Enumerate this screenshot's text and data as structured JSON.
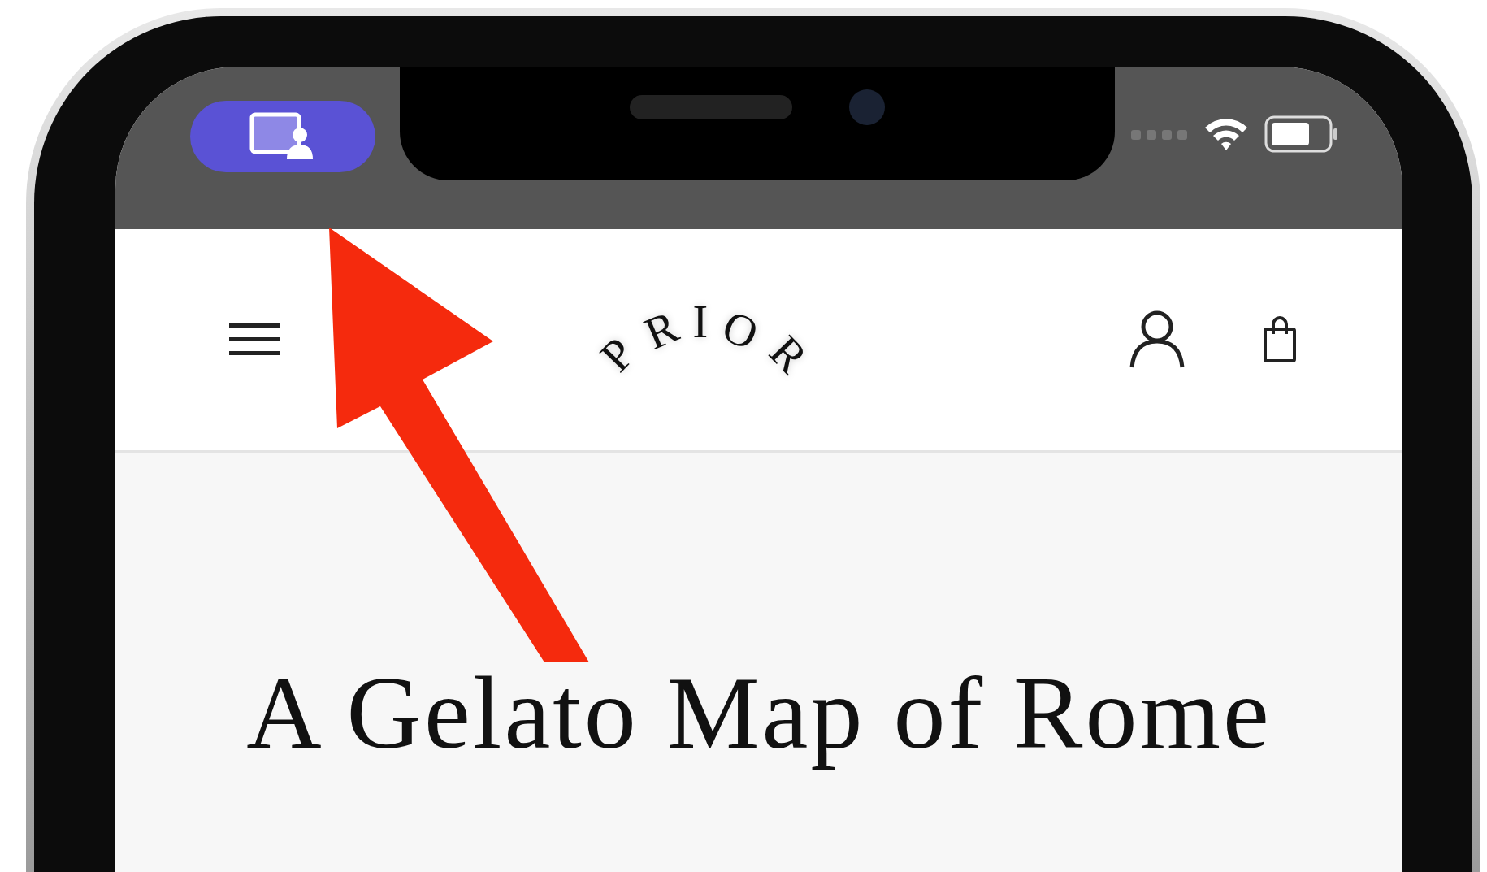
{
  "header": {
    "logo": "PRIOR"
  },
  "article": {
    "title": "A Gelato Map of Rome"
  }
}
